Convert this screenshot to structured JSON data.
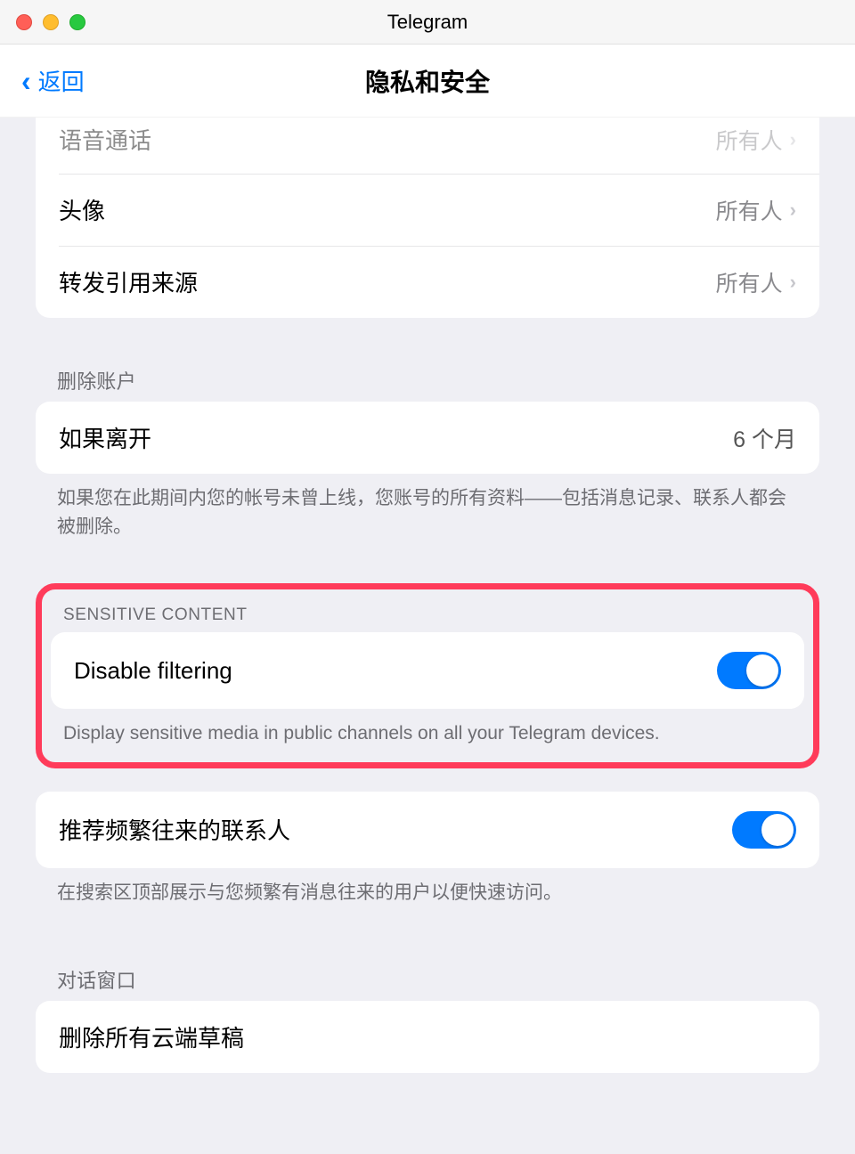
{
  "titlebar": {
    "app_title": "Telegram"
  },
  "navbar": {
    "back_label": "返回",
    "page_title": "隐私和安全"
  },
  "privacy_section": {
    "rows": [
      {
        "label": "语音通话",
        "value": "所有人"
      },
      {
        "label": "头像",
        "value": "所有人"
      },
      {
        "label": "转发引用来源",
        "value": "所有人"
      }
    ]
  },
  "delete_account": {
    "header": "删除账户",
    "row": {
      "label": "如果离开",
      "value": "6 个月"
    },
    "footer": "如果您在此期间内您的帐号未曾上线，您账号的所有资料——包括消息记录、联系人都会被删除。"
  },
  "sensitive_content": {
    "header": "SENSITIVE CONTENT",
    "row": {
      "label": "Disable filtering",
      "enabled": true
    },
    "footer": "Display sensitive media in public channels on all your Telegram devices."
  },
  "suggest_contacts": {
    "row": {
      "label": "推荐频繁往来的联系人",
      "enabled": true
    },
    "footer": "在搜索区顶部展示与您频繁有消息往来的用户以便快速访问。"
  },
  "chat_window": {
    "header": "对话窗口",
    "row": {
      "label": "删除所有云端草稿"
    }
  }
}
